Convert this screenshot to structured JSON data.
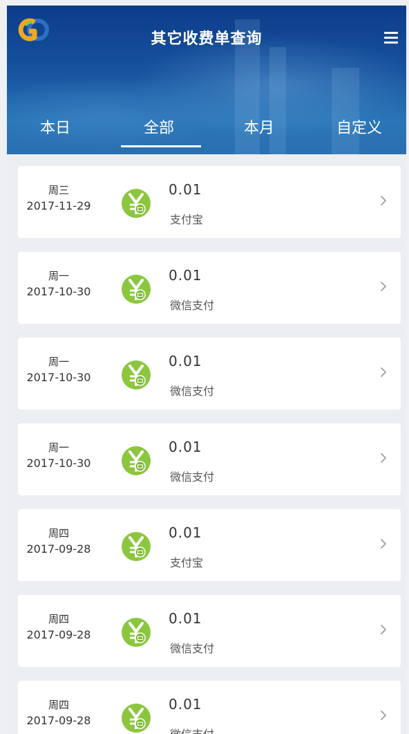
{
  "header": {
    "title": "其它收费单查询",
    "logo_icon": "gc-logo",
    "menu_icon": "hamburger-menu-icon"
  },
  "tabs": [
    {
      "label": "本日",
      "active": false
    },
    {
      "label": "全部",
      "active": true
    },
    {
      "label": "本月",
      "active": false
    },
    {
      "label": "自定义",
      "active": false
    }
  ],
  "records": [
    {
      "weekday": "周三",
      "date": "2017-11-29",
      "amount": "0.01",
      "method": "支付宝"
    },
    {
      "weekday": "周一",
      "date": "2017-10-30",
      "amount": "0.01",
      "method": "微信支付"
    },
    {
      "weekday": "周一",
      "date": "2017-10-30",
      "amount": "0.01",
      "method": "微信支付"
    },
    {
      "weekday": "周一",
      "date": "2017-10-30",
      "amount": "0.01",
      "method": "微信支付"
    },
    {
      "weekday": "周四",
      "date": "2017-09-28",
      "amount": "0.01",
      "method": "支付宝"
    },
    {
      "weekday": "周四",
      "date": "2017-09-28",
      "amount": "0.01",
      "method": "微信支付"
    },
    {
      "weekday": "周四",
      "date": "2017-09-28",
      "amount": "0.01",
      "method": "微信支付"
    }
  ],
  "colors": {
    "header_blue": "#1a4f9c",
    "icon_green": "#8cc63f",
    "page_bg": "#eceef2"
  }
}
